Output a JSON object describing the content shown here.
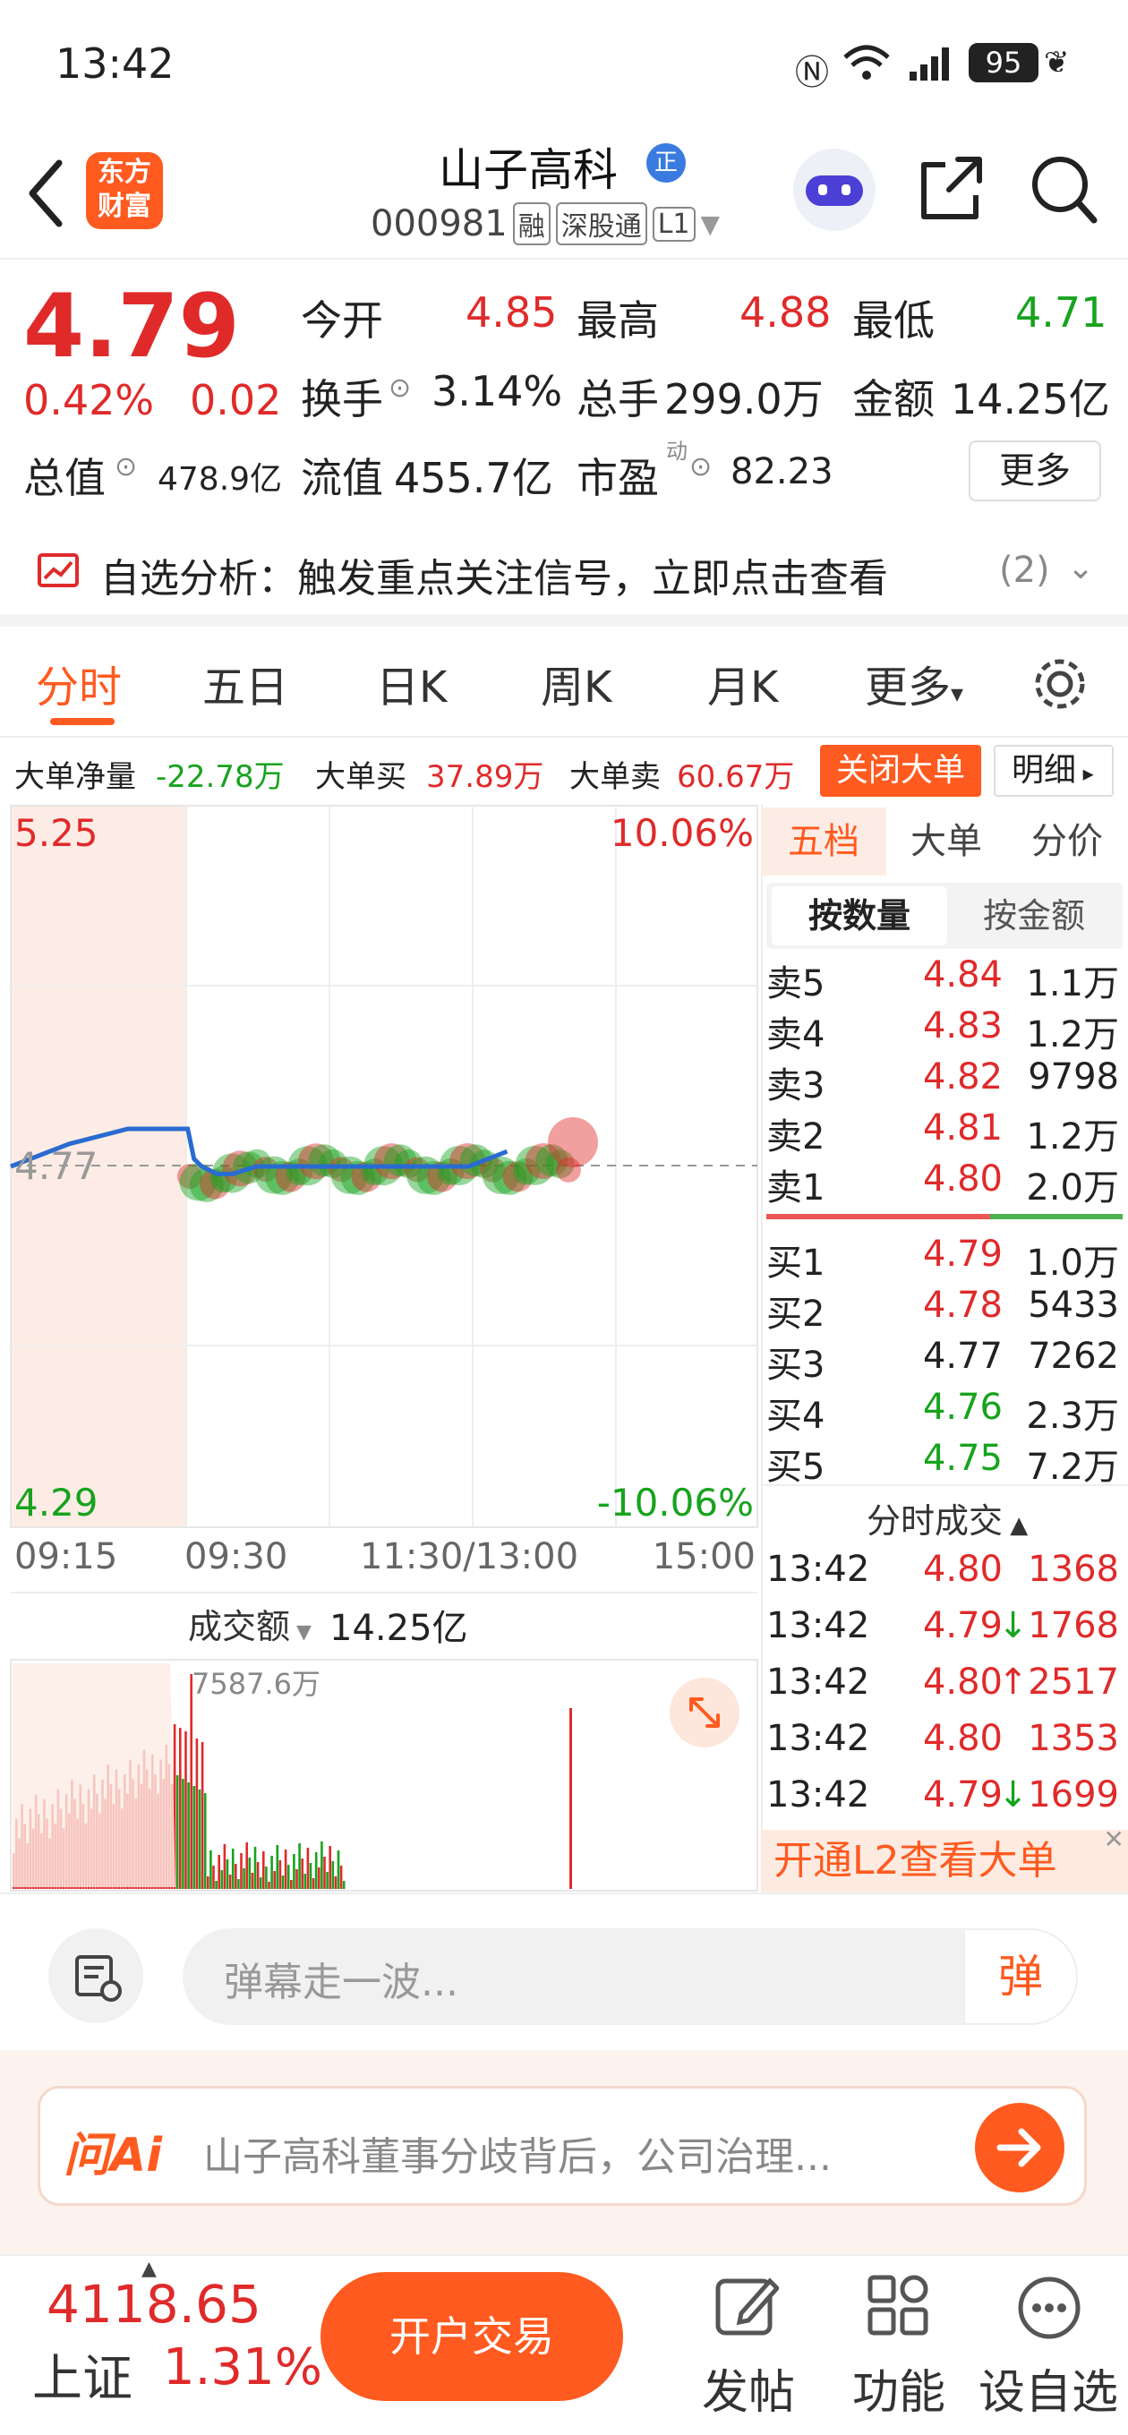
{
  "status": {
    "time": "13:42",
    "battery": "95"
  },
  "header": {
    "back_icon": "chevron-left-icon",
    "logo_line1": "东方",
    "logo_line2": "财富",
    "stock_name": "山子高科",
    "badge_zheng": "正",
    "stock_code": "000981",
    "tag_rong": "融",
    "tag_sgt": "深股通",
    "tag_l1": "L1"
  },
  "quote": {
    "price": "4.79",
    "change_pct": "0.42%",
    "change_amt": "0.02",
    "open_label": "今开",
    "open": "4.85",
    "high_label": "最高",
    "high": "4.88",
    "low_label": "最低",
    "low": "4.71",
    "turnover_label": "换手",
    "turnover": "3.14%",
    "vol_label": "总手",
    "vol": "299.0万",
    "amount_label": "金额",
    "amount": "14.25亿",
    "mcap_label": "总值",
    "mcap": "478.9亿",
    "float_label": "流值",
    "float": "455.7亿",
    "pe_label": "市盈",
    "pe_sup": "动",
    "pe": "82.23",
    "more_btn": "更多"
  },
  "analysis": {
    "text": "自选分析：触发重点关注信号，立即点击查看",
    "count": "(2)"
  },
  "tabs": {
    "items": [
      "分时",
      "五日",
      "日K",
      "周K",
      "月K",
      "更多"
    ],
    "more_arrow": "▾"
  },
  "bigorder": {
    "net_label": "大单净量",
    "net": "-22.78万",
    "buy_label": "大单买",
    "buy": "37.89万",
    "sell_label": "大单卖",
    "sell": "60.67万",
    "close_btn": "关闭大单",
    "detail_btn": "明细"
  },
  "chart": {
    "price_top": "5.25",
    "price_mid": "4.77",
    "price_bottom": "4.29",
    "pct_top": "10.06%",
    "pct_bottom": "-10.06%",
    "time_labels": [
      "09:15",
      "09:30",
      "11:30/13:00",
      "15:00"
    ],
    "volume_selector": "成交额",
    "volume_total": "14.25亿",
    "volume_peak": "7587.6万",
    "line_color": "#2a6bd1",
    "up_color": "#e02a2a",
    "down_color": "#17a31e"
  },
  "chart_data": {
    "type": "line",
    "x": [
      "09:15",
      "09:20",
      "09:25",
      "09:31",
      "09:35",
      "09:40",
      "09:50",
      "10:00",
      "10:15",
      "10:30",
      "10:45",
      "11:00",
      "11:15",
      "11:30",
      "13:00",
      "13:15",
      "13:30",
      "13:42"
    ],
    "y": [
      4.77,
      4.8,
      4.82,
      4.82,
      4.78,
      4.77,
      4.76,
      4.76,
      4.77,
      4.77,
      4.77,
      4.77,
      4.77,
      4.77,
      4.77,
      4.77,
      4.77,
      4.79
    ],
    "ylim": [
      4.29,
      5.25
    ],
    "reference": 4.77
  },
  "orderbook": {
    "tabs": [
      "五档",
      "大单",
      "分价"
    ],
    "subtabs": [
      "按数量",
      "按金额"
    ],
    "asks": [
      {
        "label": "卖5",
        "price": "4.84",
        "vol": "1.1万"
      },
      {
        "label": "卖4",
        "price": "4.83",
        "vol": "1.2万"
      },
      {
        "label": "卖3",
        "price": "4.82",
        "vol": "9798"
      },
      {
        "label": "卖2",
        "price": "4.81",
        "vol": "1.2万"
      },
      {
        "label": "卖1",
        "price": "4.80",
        "vol": "2.0万"
      }
    ],
    "bids": [
      {
        "label": "买1",
        "price": "4.79",
        "vol": "1.0万"
      },
      {
        "label": "买2",
        "price": "4.78",
        "vol": "5433"
      },
      {
        "label": "买3",
        "price": "4.77",
        "vol": "7262"
      },
      {
        "label": "买4",
        "price": "4.76",
        "vol": "2.3万"
      },
      {
        "label": "买5",
        "price": "4.75",
        "vol": "7.2万"
      }
    ],
    "trades_title": "分时成交",
    "trades": [
      {
        "time": "13:42",
        "price": "4.80",
        "vol": "1368",
        "dir": ""
      },
      {
        "time": "13:42",
        "price": "4.79",
        "vol": "1768",
        "dir": "↓"
      },
      {
        "time": "13:42",
        "price": "4.80",
        "vol": "2517",
        "dir": "↑"
      },
      {
        "time": "13:42",
        "price": "4.80",
        "vol": "1353",
        "dir": ""
      },
      {
        "time": "13:42",
        "price": "4.79",
        "vol": "1699",
        "dir": "↓"
      }
    ],
    "l2_banner": "开通L2查看大单"
  },
  "danmu": {
    "placeholder": "弹幕走一波...",
    "btn": "弹"
  },
  "ai": {
    "logo": "问Ai",
    "text": "山子高科董事分歧背后，公司治理..."
  },
  "bottom": {
    "index_value": "4118.65",
    "index_name": "上证",
    "index_change": "1.31%",
    "trade_btn": "开户交易",
    "post": "发帖",
    "func": "功能",
    "watch": "设自选"
  }
}
